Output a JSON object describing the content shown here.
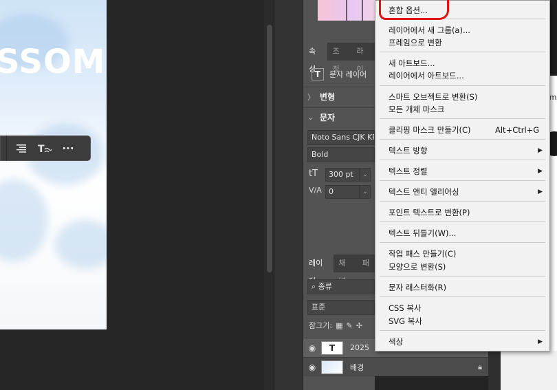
{
  "canvas": {
    "artboard_text": "SSOM",
    "toolbar": {
      "align_icon": "align-right-icon",
      "text_tool_icon": "text-warp-icon",
      "more_label": "···"
    }
  },
  "properties_panel": {
    "tabs": [
      "속성",
      "조정",
      "라이"
    ],
    "layer_type_icon": "T",
    "layer_type_label": "문자 레이어",
    "transform_section": "변형",
    "text_section": "문자",
    "font_family": "Noto Sans CJK KR",
    "font_style": "Bold",
    "font_size": "300 pt",
    "tracking": "0",
    "size_icon": "tT",
    "tracking_icon": "V/A"
  },
  "layers_panel": {
    "tabs": [
      "레이어",
      "채널",
      "패"
    ],
    "filter_label": "종류",
    "blend_mode": "표준",
    "lock_label": "잠그기:",
    "layers": [
      {
        "name": "2025",
        "type": "text",
        "thumb": "T"
      },
      {
        "name": "배경",
        "type": "image",
        "locked": true
      }
    ]
  },
  "context_menu": {
    "items": [
      {
        "label": "혼합 옵션...",
        "group": 0
      },
      {
        "label": "레이어에서 새 그룹(a)...",
        "group": 1
      },
      {
        "label": "프레임으로 변환",
        "group": 1
      },
      {
        "label": "새 아트보드...",
        "group": 2
      },
      {
        "label": "레이어에서 아트보드...",
        "group": 2
      },
      {
        "label": "스마트 오브젝트로 변환(S)",
        "group": 3
      },
      {
        "label": "모든 개체 마스크",
        "group": 3
      },
      {
        "label": "클리핑 마스크 만들기(C)",
        "shortcut": "Alt+Ctrl+G",
        "group": 4
      },
      {
        "label": "텍스트 방향",
        "submenu": true,
        "group": 5
      },
      {
        "label": "텍스트 정렬",
        "submenu": true,
        "group": 6
      },
      {
        "label": "텍스트 앤티 앨리어싱",
        "submenu": true,
        "group": 7
      },
      {
        "label": "포인트 텍스트로 변환(P)",
        "group": 8
      },
      {
        "label": "텍스트 뒤틀기(W)...",
        "group": 9
      },
      {
        "label": "작업 패스 만들기(C)",
        "group": 10
      },
      {
        "label": "모양으로 변환(S)",
        "group": 10
      },
      {
        "label": "문자 래스터화(R)",
        "group": 11
      },
      {
        "label": "CSS 복사",
        "group": 12
      },
      {
        "label": "SVG 복사",
        "group": 12
      },
      {
        "label": "색상",
        "submenu": true,
        "group": 13
      }
    ]
  },
  "side_doc": {
    "fragment_text": "em"
  },
  "colors": {
    "menu_bg": "#f2f2f2",
    "highlight_circle": "#e01212",
    "panel_bg": "#535353"
  }
}
